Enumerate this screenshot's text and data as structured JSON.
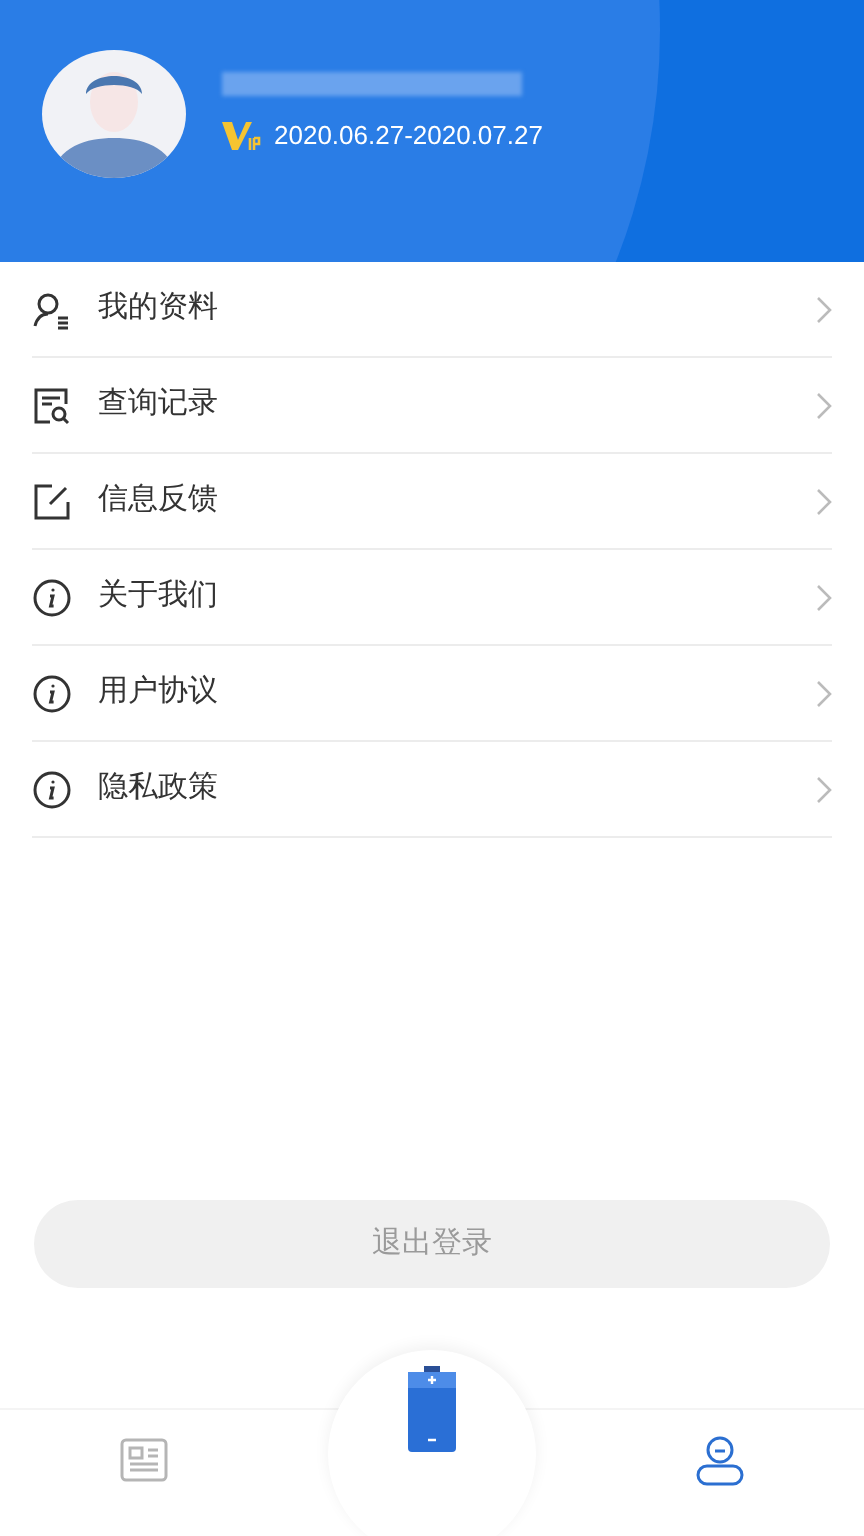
{
  "profile": {
    "vip_period": "2020.06.27-2020.07.27"
  },
  "menu": [
    {
      "kind": "profile",
      "label": "我的资料"
    },
    {
      "kind": "records",
      "label": "查询记录"
    },
    {
      "kind": "feedback",
      "label": "信息反馈"
    },
    {
      "kind": "info",
      "label": "关于我们"
    },
    {
      "kind": "info",
      "label": "用户协议"
    },
    {
      "kind": "info",
      "label": "隐私政策"
    }
  ],
  "logout": "退出登录",
  "nav": [
    {
      "kind": "news",
      "selected": false
    },
    {
      "kind": "battery",
      "selected": false
    },
    {
      "kind": "user",
      "selected": true
    }
  ]
}
